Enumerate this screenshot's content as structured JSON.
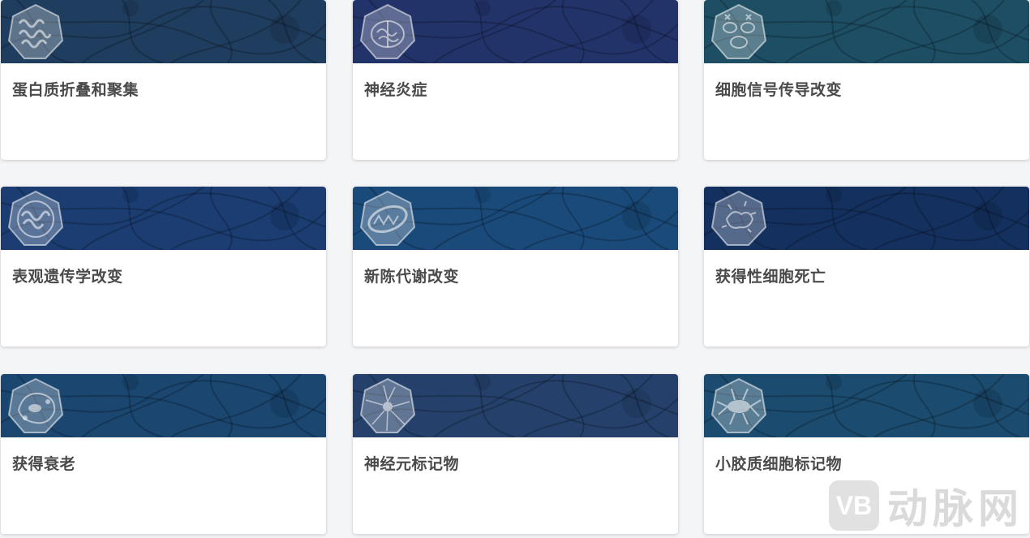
{
  "cards": [
    {
      "title": "蛋白质折叠和聚集",
      "icon": "protein-aggregate-icon",
      "color": "#1f3d5e"
    },
    {
      "title": "神经炎症",
      "icon": "brain-inflammation-icon",
      "color": "#22336a"
    },
    {
      "title": "细胞信号传导改变",
      "icon": "cell-signaling-icon",
      "color": "#1d4e64"
    },
    {
      "title": "表观遗传学改变",
      "icon": "chromatin-icon",
      "color": "#1b3d72"
    },
    {
      "title": "新陈代谢改变",
      "icon": "mitochondria-icon",
      "color": "#1a4a7a"
    },
    {
      "title": "获得性细胞死亡",
      "icon": "dying-cell-icon",
      "color": "#14305e"
    },
    {
      "title": "获得衰老",
      "icon": "senescent-cell-icon",
      "color": "#1a4670"
    },
    {
      "title": "神经元标记物",
      "icon": "neuron-icon",
      "color": "#25416b"
    },
    {
      "title": "小胶质细胞标记物",
      "icon": "microglia-icon",
      "color": "#1b4b6e"
    }
  ],
  "watermark": {
    "logo": "VB",
    "text": "动脉网"
  }
}
